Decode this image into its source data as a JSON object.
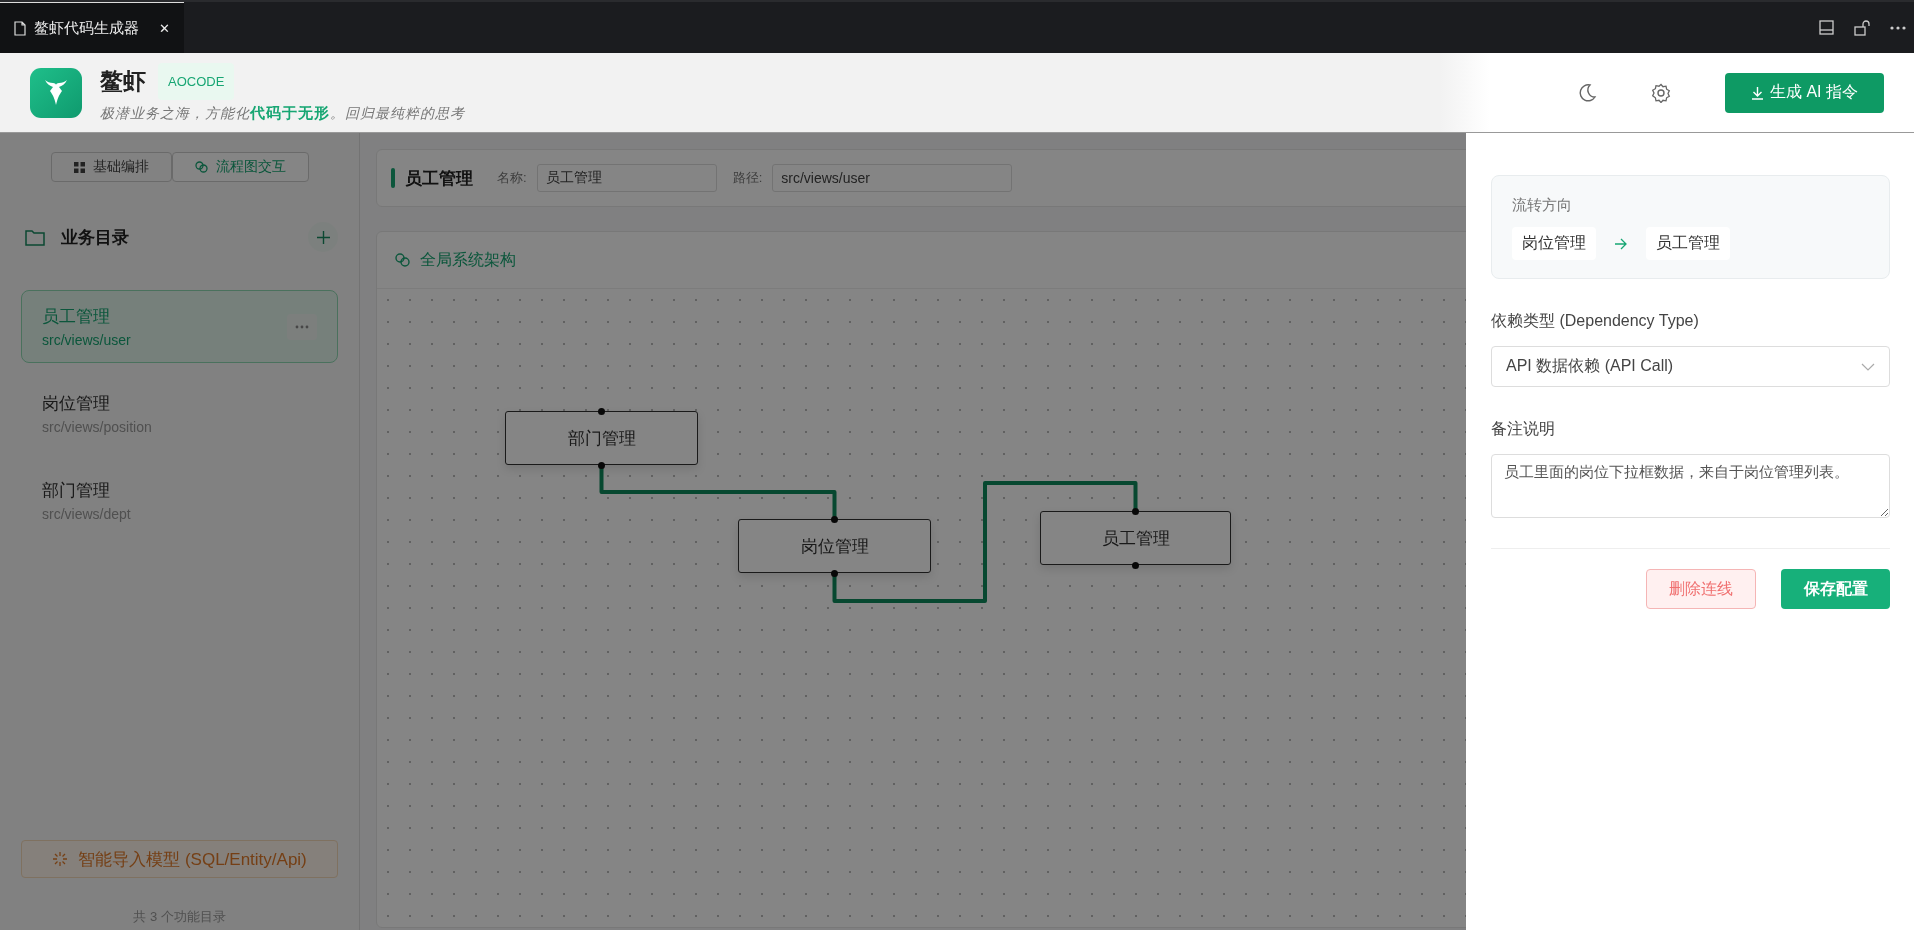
{
  "tab": {
    "title": "鳌虾代码生成器",
    "close": "✕"
  },
  "header": {
    "brand": "鳌虾",
    "badge": "AOCODE",
    "slogan": "极潜业务之海，方能化**代码于无形**。回归最纯粹的思考",
    "generate_button": "生成 AI 指令"
  },
  "sidebar": {
    "modes": [
      {
        "label": "基础编排",
        "selected": false
      },
      {
        "label": "流程图交互",
        "selected": true
      }
    ],
    "section_title": "业务目录",
    "items": [
      {
        "name": "员工管理",
        "path": "src/views/user",
        "selected": true
      },
      {
        "name": "岗位管理",
        "path": "src/views/position",
        "selected": false
      },
      {
        "name": "部门管理",
        "path": "src/views/dept",
        "selected": false
      }
    ],
    "import_button": "智能导入模型 (SQL/Entity/Api)",
    "footer": "共 3 个功能目录"
  },
  "module": {
    "title": "员工管理",
    "name_label": "名称:",
    "name_value": "员工管理",
    "path_label": "路径:",
    "path_value": "src/views/user"
  },
  "canvas": {
    "title": "全局系统架构",
    "nodes": [
      {
        "label": "部门管理"
      },
      {
        "label": "岗位管理"
      },
      {
        "label": "员工管理"
      }
    ]
  },
  "drawer": {
    "direction_label": "流转方向",
    "from": "岗位管理",
    "to": "员工管理",
    "dependency_label": "依赖类型 (Dependency Type)",
    "dependency_value": "API 数据依赖 (API Call)",
    "note_label": "备注说明",
    "note_value": "员工里面的岗位下拉框数据，来自于岗位管理列表。",
    "delete_button": "删除连线",
    "save_button": "保存配置"
  }
}
